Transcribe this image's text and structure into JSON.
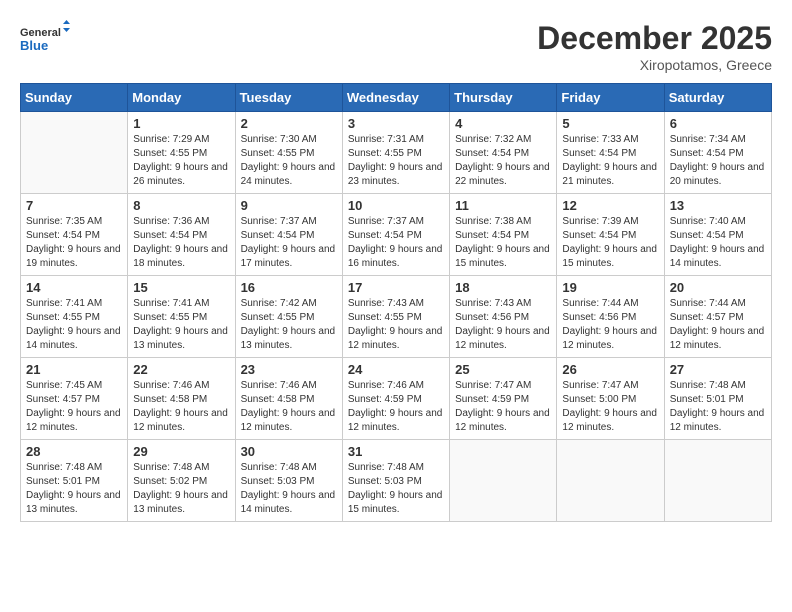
{
  "header": {
    "logo_line1": "General",
    "logo_line2": "Blue",
    "month": "December 2025",
    "location": "Xiropotamos, Greece"
  },
  "days_of_week": [
    "Sunday",
    "Monday",
    "Tuesday",
    "Wednesday",
    "Thursday",
    "Friday",
    "Saturday"
  ],
  "weeks": [
    [
      {
        "num": "",
        "sunrise": "",
        "sunset": "",
        "daylight": ""
      },
      {
        "num": "1",
        "sunrise": "Sunrise: 7:29 AM",
        "sunset": "Sunset: 4:55 PM",
        "daylight": "Daylight: 9 hours and 26 minutes."
      },
      {
        "num": "2",
        "sunrise": "Sunrise: 7:30 AM",
        "sunset": "Sunset: 4:55 PM",
        "daylight": "Daylight: 9 hours and 24 minutes."
      },
      {
        "num": "3",
        "sunrise": "Sunrise: 7:31 AM",
        "sunset": "Sunset: 4:55 PM",
        "daylight": "Daylight: 9 hours and 23 minutes."
      },
      {
        "num": "4",
        "sunrise": "Sunrise: 7:32 AM",
        "sunset": "Sunset: 4:54 PM",
        "daylight": "Daylight: 9 hours and 22 minutes."
      },
      {
        "num": "5",
        "sunrise": "Sunrise: 7:33 AM",
        "sunset": "Sunset: 4:54 PM",
        "daylight": "Daylight: 9 hours and 21 minutes."
      },
      {
        "num": "6",
        "sunrise": "Sunrise: 7:34 AM",
        "sunset": "Sunset: 4:54 PM",
        "daylight": "Daylight: 9 hours and 20 minutes."
      }
    ],
    [
      {
        "num": "7",
        "sunrise": "Sunrise: 7:35 AM",
        "sunset": "Sunset: 4:54 PM",
        "daylight": "Daylight: 9 hours and 19 minutes."
      },
      {
        "num": "8",
        "sunrise": "Sunrise: 7:36 AM",
        "sunset": "Sunset: 4:54 PM",
        "daylight": "Daylight: 9 hours and 18 minutes."
      },
      {
        "num": "9",
        "sunrise": "Sunrise: 7:37 AM",
        "sunset": "Sunset: 4:54 PM",
        "daylight": "Daylight: 9 hours and 17 minutes."
      },
      {
        "num": "10",
        "sunrise": "Sunrise: 7:37 AM",
        "sunset": "Sunset: 4:54 PM",
        "daylight": "Daylight: 9 hours and 16 minutes."
      },
      {
        "num": "11",
        "sunrise": "Sunrise: 7:38 AM",
        "sunset": "Sunset: 4:54 PM",
        "daylight": "Daylight: 9 hours and 15 minutes."
      },
      {
        "num": "12",
        "sunrise": "Sunrise: 7:39 AM",
        "sunset": "Sunset: 4:54 PM",
        "daylight": "Daylight: 9 hours and 15 minutes."
      },
      {
        "num": "13",
        "sunrise": "Sunrise: 7:40 AM",
        "sunset": "Sunset: 4:54 PM",
        "daylight": "Daylight: 9 hours and 14 minutes."
      }
    ],
    [
      {
        "num": "14",
        "sunrise": "Sunrise: 7:41 AM",
        "sunset": "Sunset: 4:55 PM",
        "daylight": "Daylight: 9 hours and 14 minutes."
      },
      {
        "num": "15",
        "sunrise": "Sunrise: 7:41 AM",
        "sunset": "Sunset: 4:55 PM",
        "daylight": "Daylight: 9 hours and 13 minutes."
      },
      {
        "num": "16",
        "sunrise": "Sunrise: 7:42 AM",
        "sunset": "Sunset: 4:55 PM",
        "daylight": "Daylight: 9 hours and 13 minutes."
      },
      {
        "num": "17",
        "sunrise": "Sunrise: 7:43 AM",
        "sunset": "Sunset: 4:55 PM",
        "daylight": "Daylight: 9 hours and 12 minutes."
      },
      {
        "num": "18",
        "sunrise": "Sunrise: 7:43 AM",
        "sunset": "Sunset: 4:56 PM",
        "daylight": "Daylight: 9 hours and 12 minutes."
      },
      {
        "num": "19",
        "sunrise": "Sunrise: 7:44 AM",
        "sunset": "Sunset: 4:56 PM",
        "daylight": "Daylight: 9 hours and 12 minutes."
      },
      {
        "num": "20",
        "sunrise": "Sunrise: 7:44 AM",
        "sunset": "Sunset: 4:57 PM",
        "daylight": "Daylight: 9 hours and 12 minutes."
      }
    ],
    [
      {
        "num": "21",
        "sunrise": "Sunrise: 7:45 AM",
        "sunset": "Sunset: 4:57 PM",
        "daylight": "Daylight: 9 hours and 12 minutes."
      },
      {
        "num": "22",
        "sunrise": "Sunrise: 7:46 AM",
        "sunset": "Sunset: 4:58 PM",
        "daylight": "Daylight: 9 hours and 12 minutes."
      },
      {
        "num": "23",
        "sunrise": "Sunrise: 7:46 AM",
        "sunset": "Sunset: 4:58 PM",
        "daylight": "Daylight: 9 hours and 12 minutes."
      },
      {
        "num": "24",
        "sunrise": "Sunrise: 7:46 AM",
        "sunset": "Sunset: 4:59 PM",
        "daylight": "Daylight: 9 hours and 12 minutes."
      },
      {
        "num": "25",
        "sunrise": "Sunrise: 7:47 AM",
        "sunset": "Sunset: 4:59 PM",
        "daylight": "Daylight: 9 hours and 12 minutes."
      },
      {
        "num": "26",
        "sunrise": "Sunrise: 7:47 AM",
        "sunset": "Sunset: 5:00 PM",
        "daylight": "Daylight: 9 hours and 12 minutes."
      },
      {
        "num": "27",
        "sunrise": "Sunrise: 7:48 AM",
        "sunset": "Sunset: 5:01 PM",
        "daylight": "Daylight: 9 hours and 12 minutes."
      }
    ],
    [
      {
        "num": "28",
        "sunrise": "Sunrise: 7:48 AM",
        "sunset": "Sunset: 5:01 PM",
        "daylight": "Daylight: 9 hours and 13 minutes."
      },
      {
        "num": "29",
        "sunrise": "Sunrise: 7:48 AM",
        "sunset": "Sunset: 5:02 PM",
        "daylight": "Daylight: 9 hours and 13 minutes."
      },
      {
        "num": "30",
        "sunrise": "Sunrise: 7:48 AM",
        "sunset": "Sunset: 5:03 PM",
        "daylight": "Daylight: 9 hours and 14 minutes."
      },
      {
        "num": "31",
        "sunrise": "Sunrise: 7:48 AM",
        "sunset": "Sunset: 5:03 PM",
        "daylight": "Daylight: 9 hours and 15 minutes."
      },
      {
        "num": "",
        "sunrise": "",
        "sunset": "",
        "daylight": ""
      },
      {
        "num": "",
        "sunrise": "",
        "sunset": "",
        "daylight": ""
      },
      {
        "num": "",
        "sunrise": "",
        "sunset": "",
        "daylight": ""
      }
    ]
  ]
}
